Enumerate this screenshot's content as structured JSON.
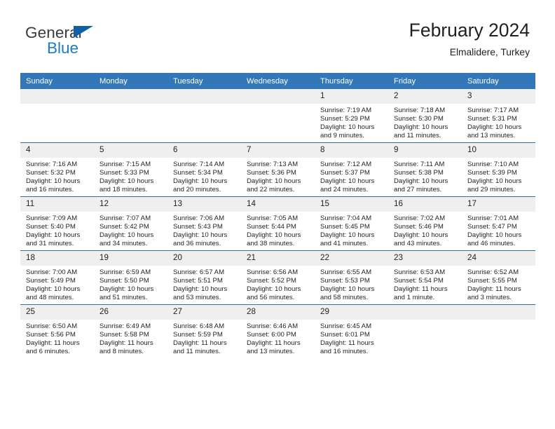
{
  "brand": {
    "name_top": "General",
    "name_bottom": "Blue"
  },
  "header": {
    "title": "February 2024",
    "subtitle": "Elmalidere, Turkey"
  },
  "colors": {
    "header_blue": "#3277b8",
    "row_rule": "#2f6fa8",
    "daynum_band": "#efefef",
    "logo_blue": "#1c7cc4",
    "text": "#231f20"
  },
  "weekdays": [
    "Sunday",
    "Monday",
    "Tuesday",
    "Wednesday",
    "Thursday",
    "Friday",
    "Saturday"
  ],
  "weeks": [
    [
      {
        "day": "",
        "blank": true
      },
      {
        "day": "",
        "blank": true
      },
      {
        "day": "",
        "blank": true
      },
      {
        "day": "",
        "blank": true
      },
      {
        "day": "1",
        "sunrise": "Sunrise: 7:19 AM",
        "sunset": "Sunset: 5:29 PM",
        "daylight": "Daylight: 10 hours and 9 minutes."
      },
      {
        "day": "2",
        "sunrise": "Sunrise: 7:18 AM",
        "sunset": "Sunset: 5:30 PM",
        "daylight": "Daylight: 10 hours and 11 minutes."
      },
      {
        "day": "3",
        "sunrise": "Sunrise: 7:17 AM",
        "sunset": "Sunset: 5:31 PM",
        "daylight": "Daylight: 10 hours and 13 minutes."
      }
    ],
    [
      {
        "day": "4",
        "sunrise": "Sunrise: 7:16 AM",
        "sunset": "Sunset: 5:32 PM",
        "daylight": "Daylight: 10 hours and 16 minutes."
      },
      {
        "day": "5",
        "sunrise": "Sunrise: 7:15 AM",
        "sunset": "Sunset: 5:33 PM",
        "daylight": "Daylight: 10 hours and 18 minutes."
      },
      {
        "day": "6",
        "sunrise": "Sunrise: 7:14 AM",
        "sunset": "Sunset: 5:34 PM",
        "daylight": "Daylight: 10 hours and 20 minutes."
      },
      {
        "day": "7",
        "sunrise": "Sunrise: 7:13 AM",
        "sunset": "Sunset: 5:36 PM",
        "daylight": "Daylight: 10 hours and 22 minutes."
      },
      {
        "day": "8",
        "sunrise": "Sunrise: 7:12 AM",
        "sunset": "Sunset: 5:37 PM",
        "daylight": "Daylight: 10 hours and 24 minutes."
      },
      {
        "day": "9",
        "sunrise": "Sunrise: 7:11 AM",
        "sunset": "Sunset: 5:38 PM",
        "daylight": "Daylight: 10 hours and 27 minutes."
      },
      {
        "day": "10",
        "sunrise": "Sunrise: 7:10 AM",
        "sunset": "Sunset: 5:39 PM",
        "daylight": "Daylight: 10 hours and 29 minutes."
      }
    ],
    [
      {
        "day": "11",
        "sunrise": "Sunrise: 7:09 AM",
        "sunset": "Sunset: 5:40 PM",
        "daylight": "Daylight: 10 hours and 31 minutes."
      },
      {
        "day": "12",
        "sunrise": "Sunrise: 7:07 AM",
        "sunset": "Sunset: 5:42 PM",
        "daylight": "Daylight: 10 hours and 34 minutes."
      },
      {
        "day": "13",
        "sunrise": "Sunrise: 7:06 AM",
        "sunset": "Sunset: 5:43 PM",
        "daylight": "Daylight: 10 hours and 36 minutes."
      },
      {
        "day": "14",
        "sunrise": "Sunrise: 7:05 AM",
        "sunset": "Sunset: 5:44 PM",
        "daylight": "Daylight: 10 hours and 38 minutes."
      },
      {
        "day": "15",
        "sunrise": "Sunrise: 7:04 AM",
        "sunset": "Sunset: 5:45 PM",
        "daylight": "Daylight: 10 hours and 41 minutes."
      },
      {
        "day": "16",
        "sunrise": "Sunrise: 7:02 AM",
        "sunset": "Sunset: 5:46 PM",
        "daylight": "Daylight: 10 hours and 43 minutes."
      },
      {
        "day": "17",
        "sunrise": "Sunrise: 7:01 AM",
        "sunset": "Sunset: 5:47 PM",
        "daylight": "Daylight: 10 hours and 46 minutes."
      }
    ],
    [
      {
        "day": "18",
        "sunrise": "Sunrise: 7:00 AM",
        "sunset": "Sunset: 5:49 PM",
        "daylight": "Daylight: 10 hours and 48 minutes."
      },
      {
        "day": "19",
        "sunrise": "Sunrise: 6:59 AM",
        "sunset": "Sunset: 5:50 PM",
        "daylight": "Daylight: 10 hours and 51 minutes."
      },
      {
        "day": "20",
        "sunrise": "Sunrise: 6:57 AM",
        "sunset": "Sunset: 5:51 PM",
        "daylight": "Daylight: 10 hours and 53 minutes."
      },
      {
        "day": "21",
        "sunrise": "Sunrise: 6:56 AM",
        "sunset": "Sunset: 5:52 PM",
        "daylight": "Daylight: 10 hours and 56 minutes."
      },
      {
        "day": "22",
        "sunrise": "Sunrise: 6:55 AM",
        "sunset": "Sunset: 5:53 PM",
        "daylight": "Daylight: 10 hours and 58 minutes."
      },
      {
        "day": "23",
        "sunrise": "Sunrise: 6:53 AM",
        "sunset": "Sunset: 5:54 PM",
        "daylight": "Daylight: 11 hours and 1 minute."
      },
      {
        "day": "24",
        "sunrise": "Sunrise: 6:52 AM",
        "sunset": "Sunset: 5:55 PM",
        "daylight": "Daylight: 11 hours and 3 minutes."
      }
    ],
    [
      {
        "day": "25",
        "sunrise": "Sunrise: 6:50 AM",
        "sunset": "Sunset: 5:56 PM",
        "daylight": "Daylight: 11 hours and 6 minutes."
      },
      {
        "day": "26",
        "sunrise": "Sunrise: 6:49 AM",
        "sunset": "Sunset: 5:58 PM",
        "daylight": "Daylight: 11 hours and 8 minutes."
      },
      {
        "day": "27",
        "sunrise": "Sunrise: 6:48 AM",
        "sunset": "Sunset: 5:59 PM",
        "daylight": "Daylight: 11 hours and 11 minutes."
      },
      {
        "day": "28",
        "sunrise": "Sunrise: 6:46 AM",
        "sunset": "Sunset: 6:00 PM",
        "daylight": "Daylight: 11 hours and 13 minutes."
      },
      {
        "day": "29",
        "sunrise": "Sunrise: 6:45 AM",
        "sunset": "Sunset: 6:01 PM",
        "daylight": "Daylight: 11 hours and 16 minutes."
      },
      {
        "day": "",
        "blank": true
      },
      {
        "day": "",
        "blank": true
      }
    ]
  ]
}
